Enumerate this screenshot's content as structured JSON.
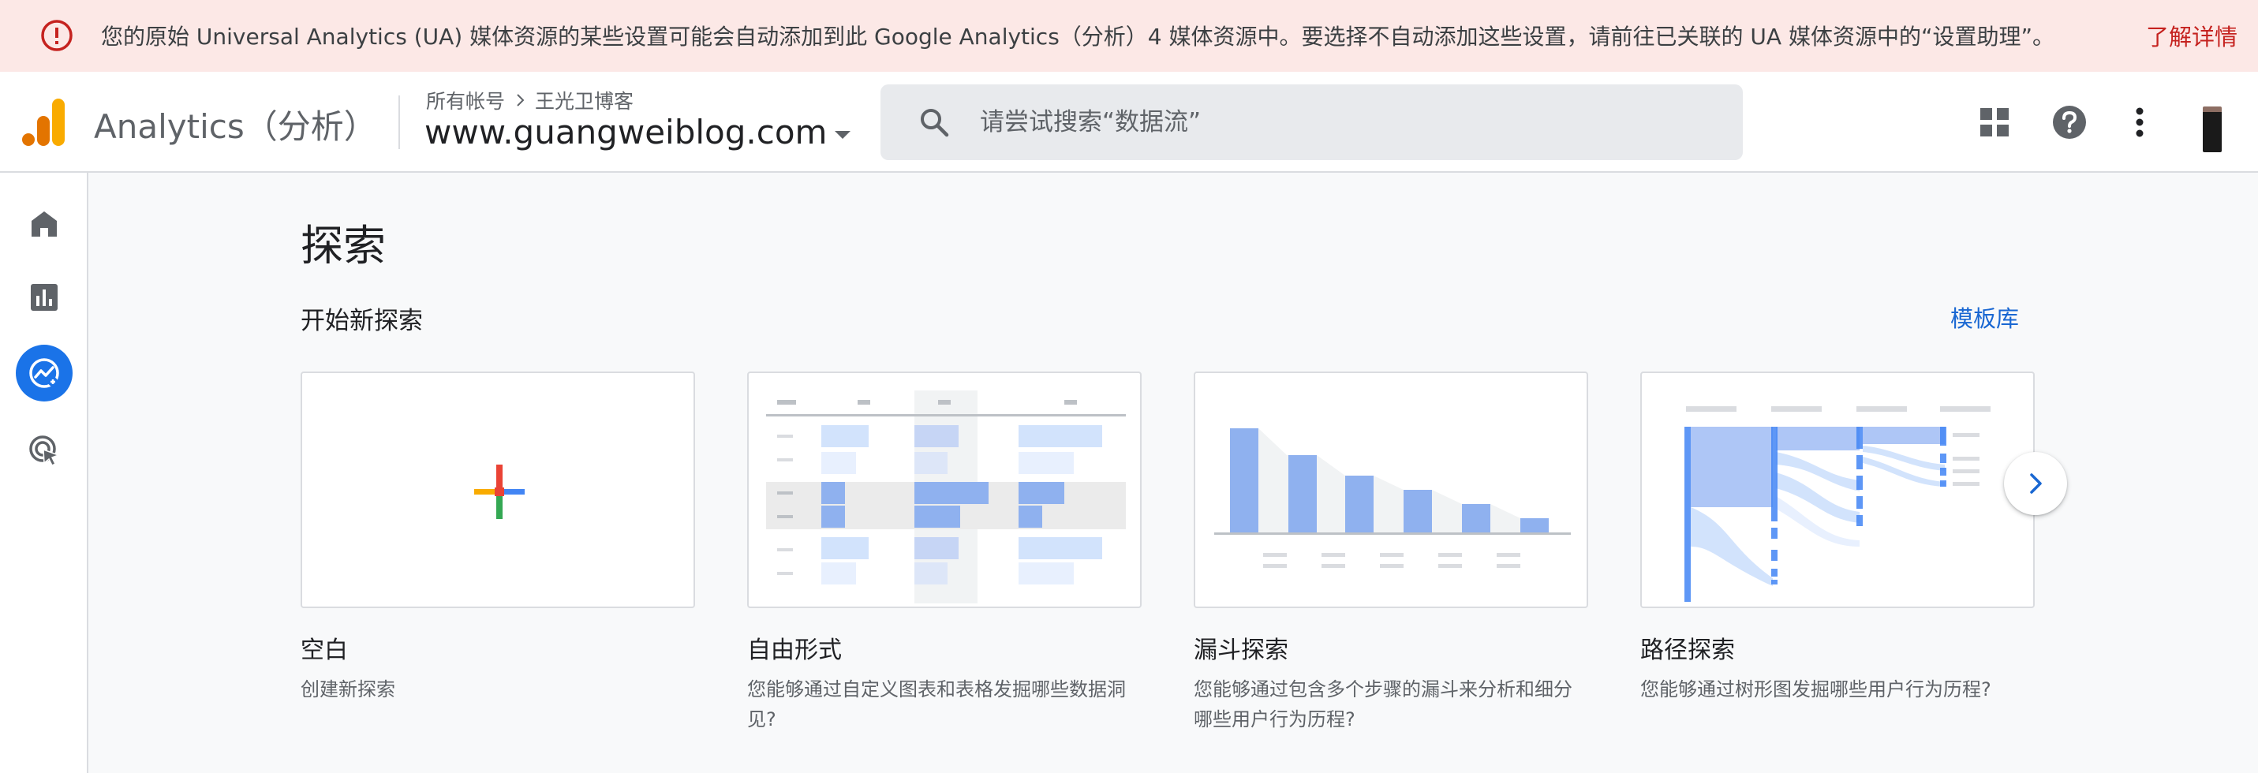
{
  "banner": {
    "message": "您的原始 Universal Analytics (UA) 媒体资源的某些设置可能会自动添加到此 Google Analytics（分析）4 媒体资源中。要选择不自动添加这些设置，请前往已关联的 UA 媒体资源中的“设置助理”。",
    "link": "了解详情",
    "icon": "error-icon"
  },
  "header": {
    "app_name": "Analytics（分析）",
    "breadcrumb": [
      "所有帐号",
      "王光卫博客"
    ],
    "property": "www.guangweiblog.com",
    "search_placeholder": "请尝试搜索“数据流”",
    "icons": [
      "apps-icon",
      "help-icon",
      "more-vert-icon"
    ]
  },
  "sidebar": {
    "items": [
      {
        "name": "home",
        "icon": "home-icon"
      },
      {
        "name": "reports",
        "icon": "bar-chart-icon"
      },
      {
        "name": "explore",
        "icon": "explore-icon",
        "active": true
      },
      {
        "name": "advertising",
        "icon": "advertising-icon"
      }
    ]
  },
  "main": {
    "title": "探索",
    "section_title": "开始新探索",
    "gallery_link": "模板库",
    "cards": [
      {
        "title": "空白",
        "desc": "创建新探索"
      },
      {
        "title": "自由形式",
        "desc": "您能够通过自定义图表和表格发掘哪些数据洞见?"
      },
      {
        "title": "漏斗探索",
        "desc": "您能够通过包含多个步骤的漏斗来分析和细分哪些用户行为历程?"
      },
      {
        "title": "路径探索",
        "desc": "您能够通过树形图发掘哪些用户行为历程?"
      }
    ]
  },
  "colors": {
    "accent": "#1a73e8",
    "banner_bg": "#fce8e6",
    "banner_link": "#c5221f",
    "thumb_blue": "#8fb1ef",
    "thumb_light_blue": "#d2e3fc"
  }
}
